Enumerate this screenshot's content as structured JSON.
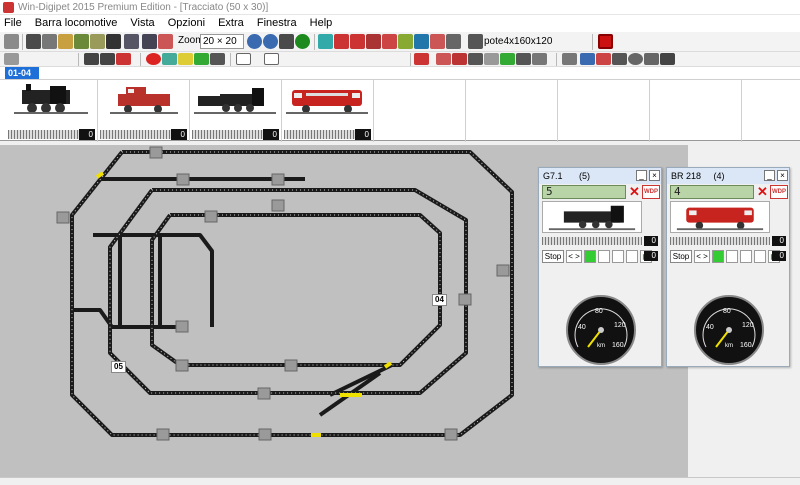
{
  "window": {
    "title": "Win-Digipet 2015 Premium Edition - [Tracciato (50 x 30)]"
  },
  "menu": [
    "File",
    "Barra locomotive",
    "Vista",
    "Opzioni",
    "Extra",
    "Finestra",
    "Help"
  ],
  "toolbar": {
    "zoom_label": "Zoom",
    "zoom_value": "20 × 20",
    "layout_name": "pote4x160x120"
  },
  "loco_tabs": [
    {
      "label": "01-04"
    }
  ],
  "loco_slots": [
    {
      "name": "steam-tank-locomotive",
      "speed": "0",
      "color": "#333"
    },
    {
      "name": "red-diesel-shunter",
      "speed": "0",
      "color": "#b8312b"
    },
    {
      "name": "steam-tender-locomotive",
      "speed": "0",
      "color": "#333"
    },
    {
      "name": "red-diesel-br218",
      "speed": "0",
      "color": "#c8241f"
    }
  ],
  "layout": {
    "labels": {
      "block_04": "04",
      "block_05": "05"
    }
  },
  "controllers": [
    {
      "title": "G7.1",
      "address": "(5)",
      "direction_icon": "lightbulb-icon",
      "step": "5",
      "speed_value": "0",
      "stop_label": "Stop",
      "arrows": "< >",
      "fn_value": "0",
      "gauge": {
        "ticks": [
          "40",
          "80",
          "120",
          "160"
        ],
        "unit": "km"
      }
    },
    {
      "title": "BR 218",
      "address": "(4)",
      "direction_icon": "lightbulb-icon",
      "step": "4",
      "speed_value": "0",
      "stop_label": "Stop",
      "arrows": "< >",
      "fn_value": "0",
      "gauge": {
        "ticks": [
          "40",
          "80",
          "120",
          "160"
        ],
        "unit": "km"
      }
    }
  ],
  "colors": {
    "accent": "#1e6fd8",
    "track": "#222222",
    "layout_bg": "#c0c0c0",
    "occupied": "#f0e000"
  }
}
